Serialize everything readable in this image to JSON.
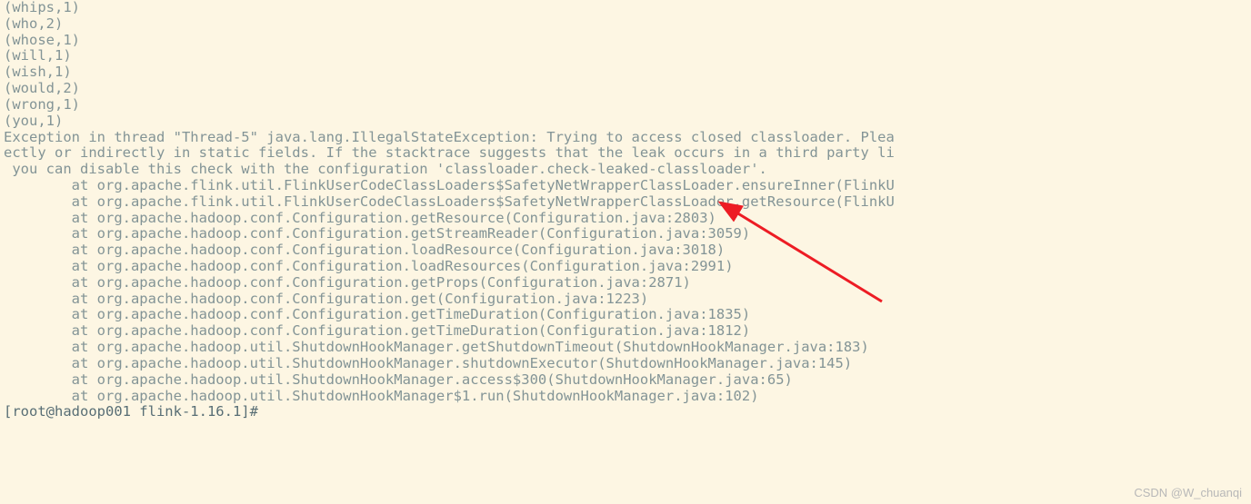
{
  "terminal": {
    "output_lines": [
      "(whips,1)",
      "(who,2)",
      "(whose,1)",
      "(will,1)",
      "(wish,1)",
      "(would,2)",
      "(wrong,1)",
      "(you,1)"
    ],
    "exception_lines": [
      "Exception in thread \"Thread-5\" java.lang.IllegalStateException: Trying to access closed classloader. Plea",
      "ectly or indirectly in static fields. If the stacktrace suggests that the leak occurs in a third party li",
      " you can disable this check with the configuration 'classloader.check-leaked-classloader'.",
      "        at org.apache.flink.util.FlinkUserCodeClassLoaders$SafetyNetWrapperClassLoader.ensureInner(FlinkU",
      "        at org.apache.flink.util.FlinkUserCodeClassLoaders$SafetyNetWrapperClassLoader.getResource(FlinkU",
      "        at org.apache.hadoop.conf.Configuration.getResource(Configuration.java:2803)",
      "        at org.apache.hadoop.conf.Configuration.getStreamReader(Configuration.java:3059)",
      "        at org.apache.hadoop.conf.Configuration.loadResource(Configuration.java:3018)",
      "        at org.apache.hadoop.conf.Configuration.loadResources(Configuration.java:2991)",
      "        at org.apache.hadoop.conf.Configuration.getProps(Configuration.java:2871)",
      "        at org.apache.hadoop.conf.Configuration.get(Configuration.java:1223)",
      "        at org.apache.hadoop.conf.Configuration.getTimeDuration(Configuration.java:1835)",
      "        at org.apache.hadoop.conf.Configuration.getTimeDuration(Configuration.java:1812)",
      "        at org.apache.hadoop.util.ShutdownHookManager.getShutdownTimeout(ShutdownHookManager.java:183)",
      "        at org.apache.hadoop.util.ShutdownHookManager.shutdownExecutor(ShutdownHookManager.java:145)",
      "        at org.apache.hadoop.util.ShutdownHookManager.access$300(ShutdownHookManager.java:65)",
      "        at org.apache.hadoop.util.ShutdownHookManager$1.run(ShutdownHookManager.java:102)"
    ],
    "prompt": "[root@hadoop001 flink-1.16.1]#"
  },
  "annotation": {
    "arrow_color": "#ed1c24"
  },
  "watermark": "CSDN @W_chuanqi"
}
